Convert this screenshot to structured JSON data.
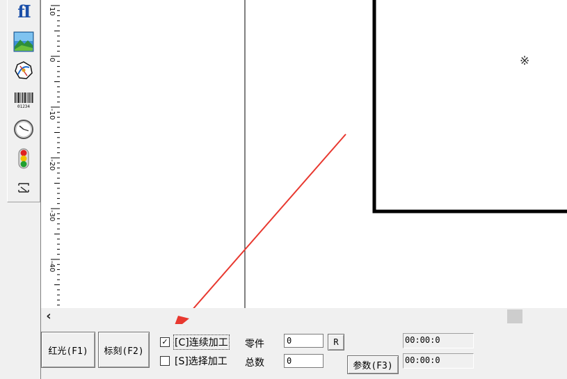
{
  "toolbar": {
    "tools": [
      {
        "name": "text-tool",
        "icon": "text-cursor-icon"
      },
      {
        "name": "image-tool",
        "icon": "landscape-image-icon"
      },
      {
        "name": "vector-tool",
        "icon": "vector-import-icon"
      },
      {
        "name": "barcode-tool",
        "icon": "barcode-icon",
        "text": "01234"
      },
      {
        "name": "clock-tool",
        "icon": "clock-icon"
      },
      {
        "name": "io-tool",
        "icon": "traffic-light-icon"
      },
      {
        "name": "extend-tool",
        "icon": "extend-axis-icon"
      }
    ],
    "text_glyph": "fI"
  },
  "ruler": {
    "labels": [
      "10",
      "0",
      "-10",
      "-20",
      "-30",
      "-40"
    ]
  },
  "canvas": {
    "marker_glyph": "※",
    "annotation_color": "#e8382f"
  },
  "scrollbar": {
    "left_arrow": "‹"
  },
  "bottom": {
    "red_light_button": "红光(F1)",
    "mark_button": "标刻(F2)",
    "continuous_label": "[C]连续加工",
    "continuous_checked": "✓",
    "select_label": "[S]选择加工",
    "parts_label": "零件",
    "parts_value": "0",
    "total_label": "总数",
    "total_value": "0",
    "reset_button": "R",
    "params_button": "参数(F3)",
    "time1": "00:00:0",
    "time2": "00:00:0"
  }
}
